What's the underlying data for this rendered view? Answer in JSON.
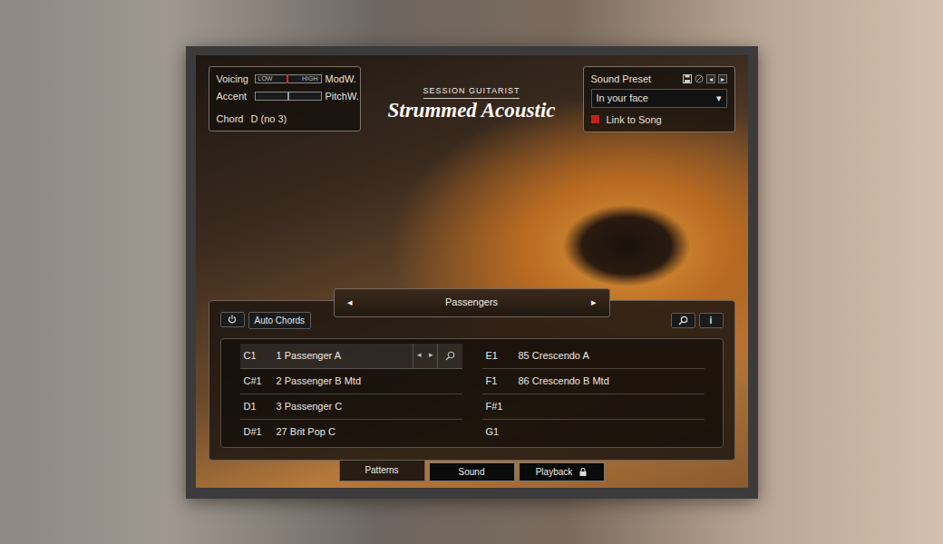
{
  "controls": {
    "voicing": {
      "label": "Voicing",
      "low": "LOW",
      "high": "HIGH",
      "level": 0.49
    },
    "accent": {
      "label": "Accent",
      "level": 0.5
    },
    "mod_wheel": "ModW.",
    "pitch_wheel": "PitchW.",
    "chord": {
      "label": "Chord",
      "value": "D (no 3)"
    }
  },
  "logo": {
    "overline": "SESSION GUITARIST",
    "title": "Strummed Acoustic"
  },
  "preset": {
    "label": "Sound Preset",
    "prev": "◂",
    "next": "▸",
    "value": "In your face",
    "caret": "▾",
    "link_to_song": {
      "label": "Link to Song",
      "checked": true
    }
  },
  "song": {
    "prev": "◂",
    "title": "Passengers",
    "next": "▸"
  },
  "toolbar": {
    "auto_chords": "Auto Chords",
    "info": "i"
  },
  "pattern_nav": {
    "prev": "◂",
    "next": "▸"
  },
  "patterns": [
    {
      "key": "C1",
      "name": "1 Passenger A",
      "selected": true
    },
    {
      "key": "C#1",
      "name": "2 Passenger B Mtd",
      "selected": false
    },
    {
      "key": "D1",
      "name": "3 Passenger C",
      "selected": false
    },
    {
      "key": "D#1",
      "name": "27 Brit Pop C",
      "selected": false
    },
    {
      "key": "E1",
      "name": "85 Crescendo A",
      "selected": false
    },
    {
      "key": "F1",
      "name": "86 Crescendo B Mtd",
      "selected": false
    },
    {
      "key": "F#1",
      "selected": false
    },
    {
      "key": "G1",
      "selected": false
    }
  ],
  "tabs": [
    {
      "label": "Patterns",
      "selected": true,
      "locked": false
    },
    {
      "label": "Sound",
      "selected": false,
      "locked": false
    },
    {
      "label": "Playback",
      "selected": false,
      "locked": true
    }
  ]
}
